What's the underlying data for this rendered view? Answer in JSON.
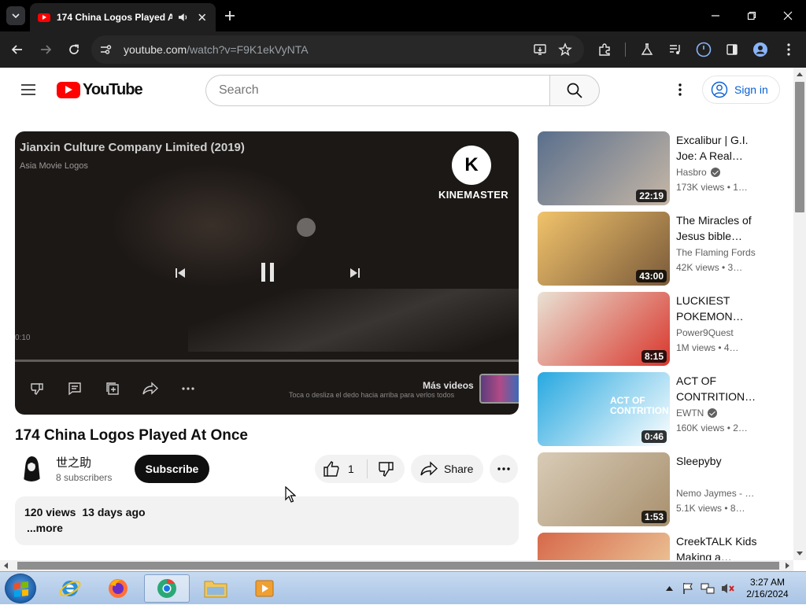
{
  "browser": {
    "tab_title": "174 China Logos Played At Once",
    "url_host": "youtube.com",
    "url_path": "/watch?v=F9K1ekVyNTA"
  },
  "masthead": {
    "logo_text": "YouTube",
    "search_placeholder": "Search",
    "signin_label": "Sign in"
  },
  "player": {
    "overlay_title": "Jianxin Culture Company Limited (2019)",
    "overlay_subtitle": "Asia Movie Logos",
    "watermark_text": "KINEMASTER",
    "watermark_letter": "K",
    "time": "0:10",
    "progress_fraction": 0.0,
    "more_videos_label": "Más videos",
    "more_videos_hint": "Toca o desliza el dedo hacia arriba para verlos todos"
  },
  "video": {
    "title": "174 China Logos Played At Once",
    "channel_name": "世之助",
    "subscribers": "8 subscribers",
    "subscribe_label": "Subscribe",
    "like_count": "1",
    "share_label": "Share",
    "views": "120 views",
    "age": "13 days ago",
    "more_label": "...more"
  },
  "recommendations": [
    {
      "title": "Excalibur | G.I. Joe: A Real…",
      "channel": "Hasbro",
      "verified": true,
      "stats": "173K views  • 1…",
      "duration": "22:19",
      "thumb_colors": [
        "#5a6f8c",
        "#c6b7a6"
      ]
    },
    {
      "title": "The Miracles of Jesus bible…",
      "channel": "The Flaming Fords",
      "verified": false,
      "stats": "42K views  • 3…",
      "duration": "43:00",
      "thumb_colors": [
        "#f1c36b",
        "#7a5a3a"
      ]
    },
    {
      "title": "LUCKIEST POKEMON…",
      "channel": "Power9Quest",
      "verified": false,
      "stats": "1M views  • 4…",
      "duration": "8:15",
      "thumb_colors": [
        "#e9e2d4",
        "#d9362c"
      ]
    },
    {
      "title": "ACT OF CONTRITION…",
      "channel": "EWTN",
      "verified": true,
      "stats": "160K views  • 2…",
      "duration": "0:46",
      "thumb_colors": [
        "#27a8e0",
        "#ffffff"
      ],
      "thumb_text": "ACT OF CONTRITION"
    },
    {
      "title": "Sleepyby",
      "channel": "Nemo Jaymes - …",
      "verified": false,
      "stats": "5.1K views  • 8…",
      "duration": "1:53",
      "thumb_colors": [
        "#d8cbb6",
        "#a8906e"
      ]
    },
    {
      "title": "CreekTALK Kids Making a…",
      "channel": "",
      "verified": false,
      "stats": "",
      "duration": "",
      "thumb_colors": [
        "#d6694a",
        "#f0d6a6"
      ]
    }
  ],
  "taskbar": {
    "time": "3:27 AM",
    "date": "2/16/2024",
    "apps": [
      "internet-explorer",
      "firefox",
      "chrome",
      "file-explorer",
      "media-player"
    ]
  },
  "colors": {
    "youtube_red": "#ff0000",
    "link_blue": "#065fd4",
    "chrome_dark": "#1f1f1f"
  }
}
